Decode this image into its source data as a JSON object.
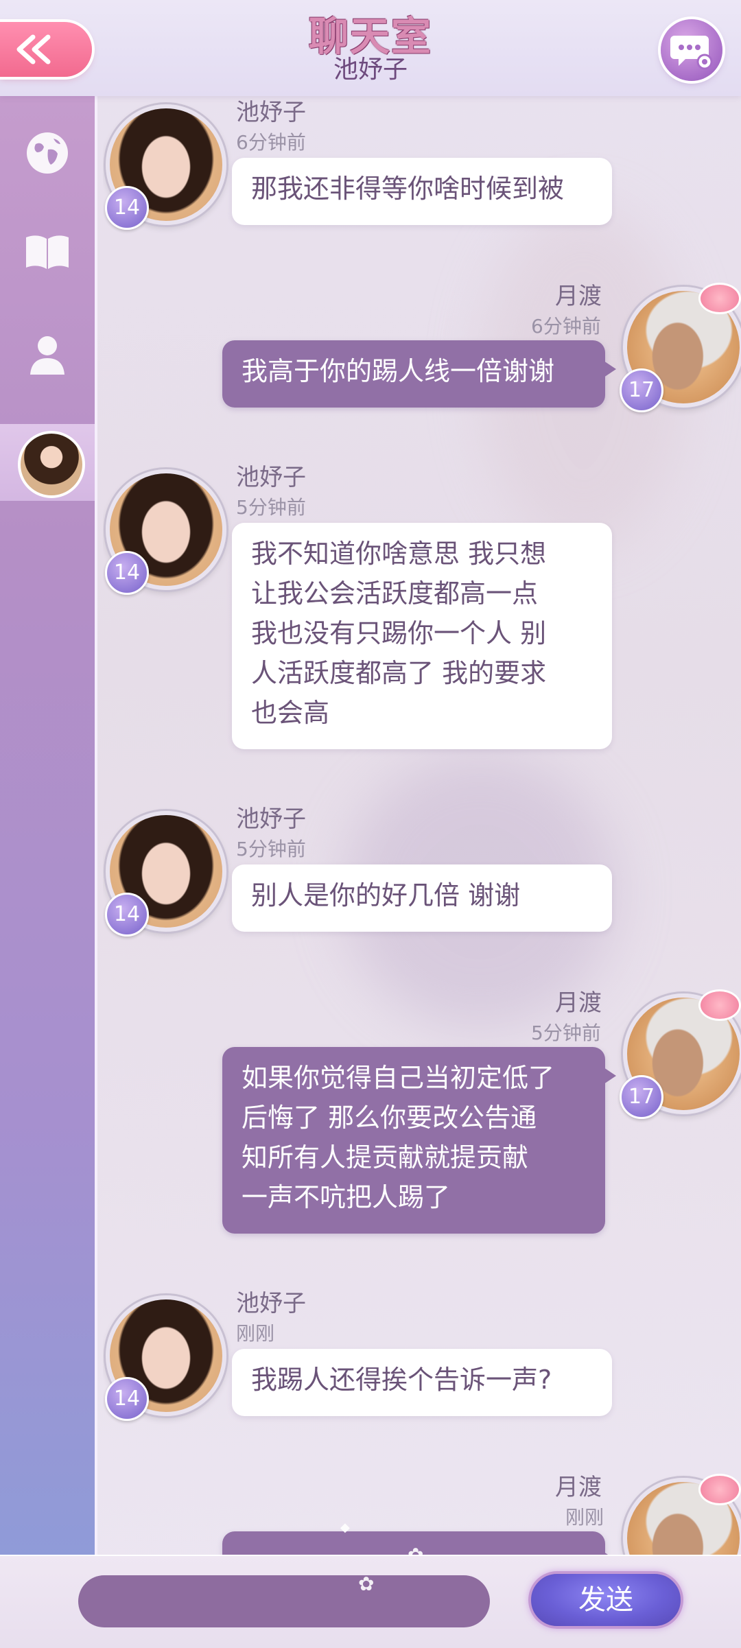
{
  "header": {
    "title": "聊天室",
    "subtitle": "池妤子",
    "back_icon": "double-chevron-left-icon",
    "settings_icon": "chat-settings-icon"
  },
  "sidebar": {
    "items": [
      {
        "icon": "globe-icon"
      },
      {
        "icon": "book-icon"
      },
      {
        "icon": "person-icon"
      },
      {
        "icon": "avatar-thumbnail",
        "selected": true
      }
    ]
  },
  "messages": [
    {
      "sender": "池妤子",
      "time": "6分钟前",
      "level": "14",
      "direction": "in",
      "text": "那我还非得等你啥时候到被"
    },
    {
      "sender": "月渡",
      "time": "6分钟前",
      "level": "17",
      "direction": "out",
      "text": "我高于你的踢人线一倍谢谢"
    },
    {
      "sender": "池妤子",
      "time": "5分钟前",
      "level": "14",
      "direction": "in",
      "lines": [
        "我不知道你啥意思 我只想",
        "让我公会活跃度都高一点",
        "我也没有只踢你一个人 别",
        "人活跃度都高了 我的要求",
        "也会高"
      ]
    },
    {
      "sender": "池妤子",
      "time": "5分钟前",
      "level": "14",
      "direction": "in",
      "text": "别人是你的好几倍 谢谢"
    },
    {
      "sender": "月渡",
      "time": "5分钟前",
      "level": "17",
      "direction": "out",
      "lines": [
        "如果你觉得自己当初定低了",
        "后悔了 那么你要改公告通",
        "知所有人提贡献就提贡献",
        "一声不吭把人踢了"
      ]
    },
    {
      "sender": "池妤子",
      "time": "刚刚",
      "level": "14",
      "direction": "in",
      "text": "我踢人还得挨个告诉一声?"
    },
    {
      "sender": "月渡",
      "time": "刚刚",
      "level": "17",
      "direction": "out",
      "text": ""
    }
  ],
  "footer": {
    "input_value": "",
    "send_label": "发送"
  },
  "colors": {
    "accent_pink": "#f26a8f",
    "outgoing_bubble": "#9170a6",
    "incoming_bubble": "#ffffff",
    "level_badge": "#8f79d6"
  }
}
